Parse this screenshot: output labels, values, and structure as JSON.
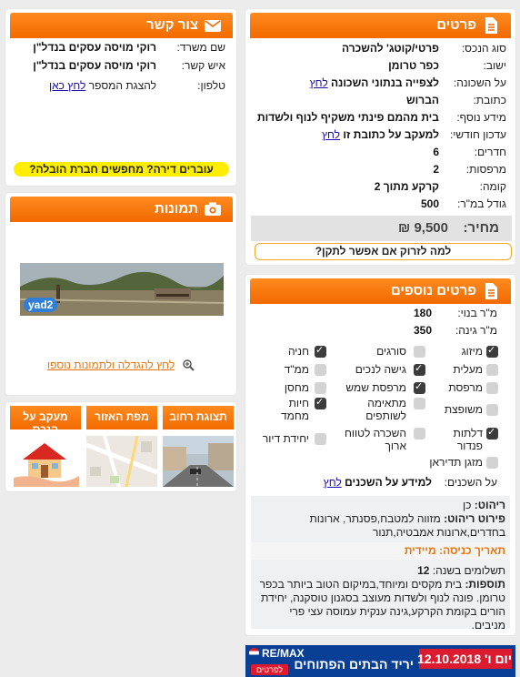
{
  "details": {
    "title": "פרטים",
    "rows": [
      {
        "label": "סוג הנכס:",
        "value": "פרטי/קוטג' להשכרה"
      },
      {
        "label": "ישוב:",
        "value": "כפר טרומן"
      },
      {
        "label": "על השכונה:",
        "value": "לצפייה בנתוני השכונה",
        "link": "לחץ"
      },
      {
        "label": "כתובת:",
        "value": "הברוש"
      },
      {
        "label": "מידע נוסף:",
        "value": "בית מהמם פינתי משקיף לנוף ולשדות"
      },
      {
        "label": "עדכון חודשי:",
        "value": "למעקב על כתובת זו",
        "link": "לחץ"
      },
      {
        "label": "חדרים:",
        "value": "6"
      },
      {
        "label": "מרפסות:",
        "value": "2"
      },
      {
        "label": "קומה:",
        "value": "קרקע מתוך 2"
      },
      {
        "label": "גודל במ\"ר:",
        "value": "500"
      }
    ],
    "price_label": "מחיר:",
    "price_value": "9,500 ₪",
    "cheaper_button": "למה לזרוק אם אפשר לתקן?"
  },
  "contact": {
    "title": "צור קשר",
    "rows": [
      {
        "label": "שם משרד:",
        "value": "רוקי מויסה עסקים בנדל\"ן"
      },
      {
        "label": "איש קשר:",
        "value": "רוקי מויסה עסקים בנדל\"ן"
      }
    ],
    "phone_label": "טלפון:",
    "phone_text": "להצגת המספר",
    "phone_link": "לחץ כאן",
    "moving_button": "עוברים דירה? מחפשים חברת הובלה?"
  },
  "photos": {
    "title": "תמונות",
    "watermark": "yad2",
    "enlarge_link": "לחץ להגדלה ולתמונות נוספו"
  },
  "tabs": [
    {
      "label": "תצוגת רחוב"
    },
    {
      "label": "מפת האזור"
    },
    {
      "label": "מעקב על הנכס"
    }
  ],
  "extra": {
    "title": "פרטים נוספים",
    "rows": [
      {
        "label": "מ\"ר בנוי:",
        "value": "180"
      },
      {
        "label": "מ\"ר גינה:",
        "value": "350"
      }
    ],
    "features": [
      {
        "label": "מיזוג",
        "checked": true
      },
      {
        "label": "סורגים",
        "checked": false
      },
      {
        "label": "חניה",
        "checked": true
      },
      {
        "label": "מעלית",
        "checked": false
      },
      {
        "label": "גישה לנכים",
        "checked": true
      },
      {
        "label": "ממ\"ד",
        "checked": false
      },
      {
        "label": "מרפסת",
        "checked": false
      },
      {
        "label": "מרפסת שמש",
        "checked": true
      },
      {
        "label": "מחסן",
        "checked": false
      },
      {
        "label": "משופצת",
        "checked": false
      },
      {
        "label": "מתאימה לשותפים",
        "checked": false
      },
      {
        "label": "חיות מחמד",
        "checked": true
      },
      {
        "label": "דלתות פנדור",
        "checked": true
      },
      {
        "label": "השכרה לטווח ארוך",
        "checked": false
      },
      {
        "label": "יחידת דיור",
        "checked": false
      },
      {
        "label": "מזגן תדיראן",
        "checked": false
      }
    ],
    "neighbors_label": "על השכנים:",
    "neighbors_text": "למידע על השכנים",
    "neighbors_link": "לחץ"
  },
  "notes": {
    "furniture_label": "ריהוט:",
    "furniture_value": "כן",
    "furniture_detail_label": "פירוט ריהוט:",
    "furniture_detail_value": "מזווה למטבח,פסנתר, ארונות בחדרים,ארונות אמבטיה,תנור",
    "entry_date_label": "תאריך כניסה:",
    "entry_date_value": "מיידית",
    "payments_label": "תשלומים בשנה:",
    "payments_value": "12",
    "additions_label": "תוספות:",
    "additions_value": "בית מקסים ומיוחד,במיקום הטוב ביותר בכפר טרומן. פונה לנוף ולשדות מעוצב בסגנון טוסקנה, יחידת הורים בקומת הקרקע,גינה ענקית עמוסה עצי פרי מניבים."
  },
  "banner": {
    "brand": "RE/MAX",
    "text": "יריד הבתים הפתוחים",
    "cta": "לפרטים",
    "day": "יום ו'",
    "date": "12.10.2018"
  },
  "colors": {
    "orange": "#f26a00",
    "yellow": "#ffee00",
    "remax_blue": "#003da5",
    "remax_red": "#dc1c2e"
  }
}
